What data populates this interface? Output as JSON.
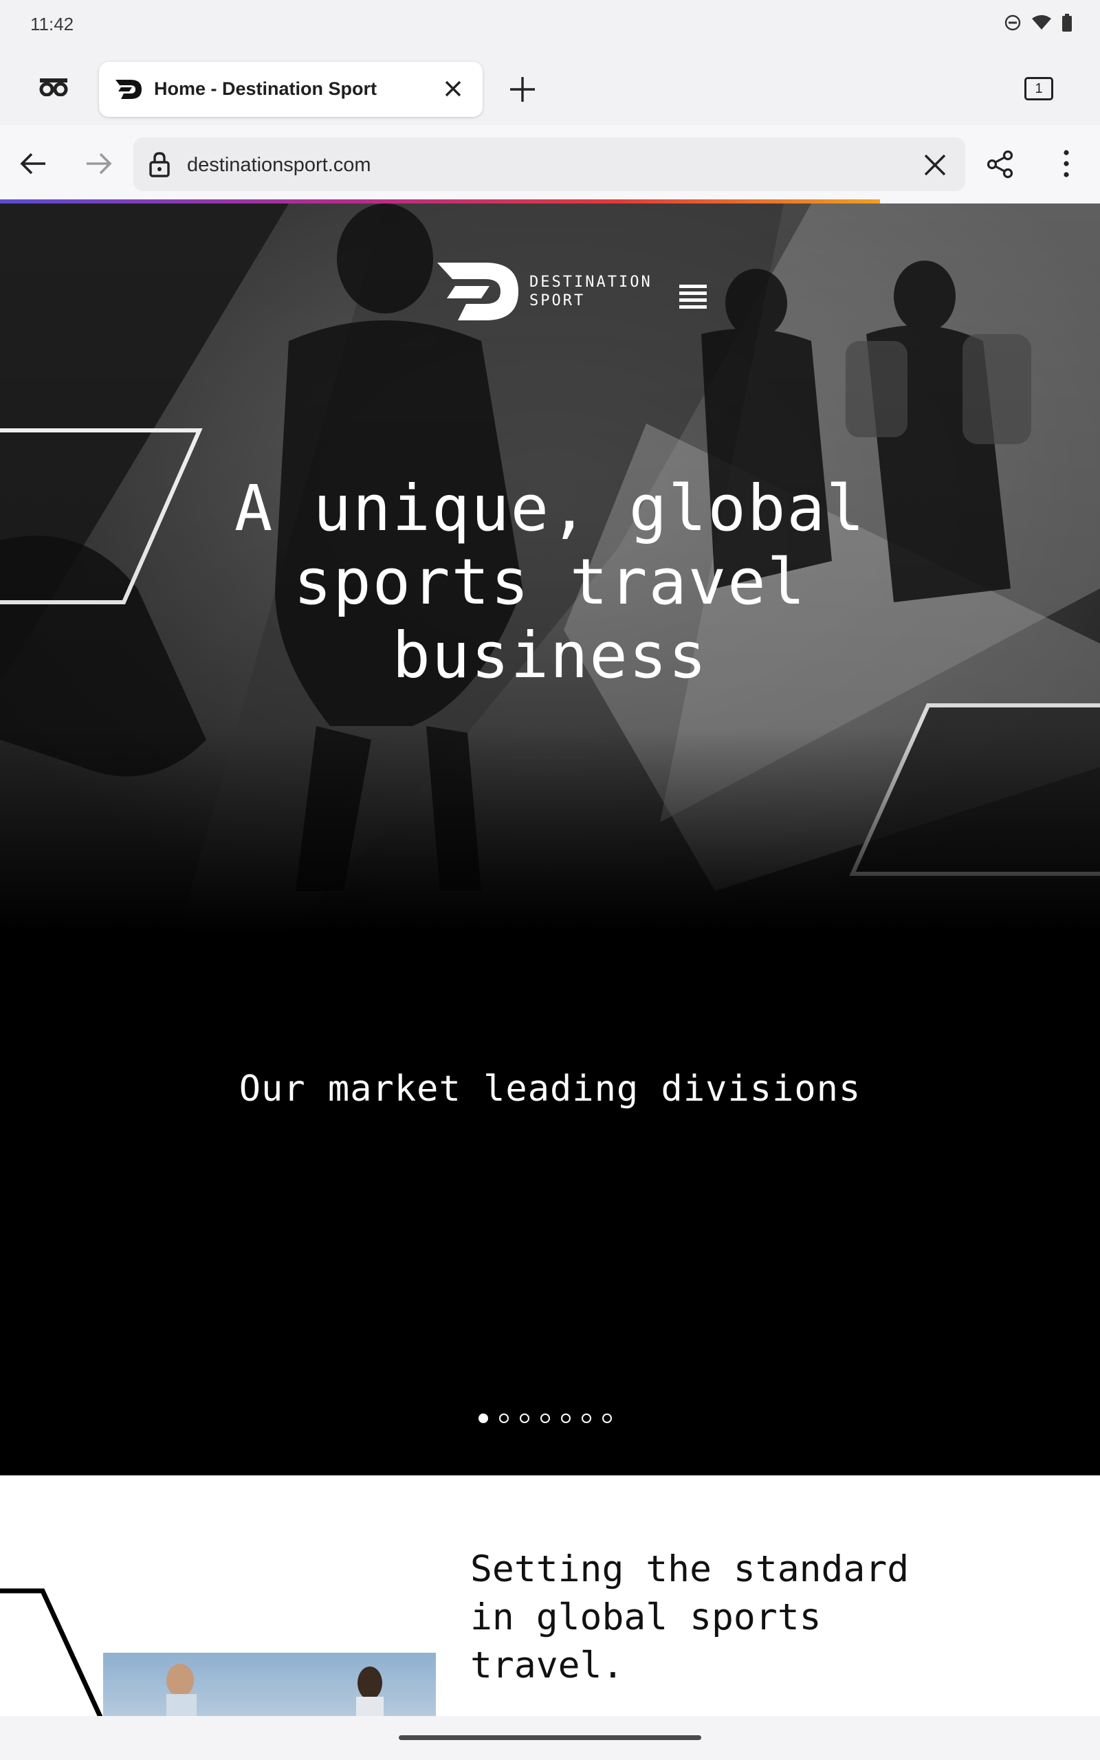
{
  "status": {
    "time": "11:42"
  },
  "browser": {
    "tab_title": "Home - Destination Sport",
    "tab_count": "1",
    "url": "destinationsport.com"
  },
  "icons": [
    "incognito-icon",
    "site-favicon",
    "close-tab-icon",
    "new-tab-icon",
    "tab-switcher-icon",
    "back-arrow-icon",
    "forward-arrow-icon",
    "lock-icon",
    "clear-url-icon",
    "share-icon",
    "more-menu-icon",
    "hamburger-menu-icon"
  ],
  "site": {
    "brand_line1": "DESTINATION",
    "brand_line2": "SPORT",
    "headline_line1": "A unique, global",
    "headline_line2": "sports travel",
    "headline_line3": "business",
    "divisions_heading": "Our market leading divisions",
    "carousel_slide_count": 7,
    "carousel_active_slide": 1,
    "intro_line1": "Setting the standard",
    "intro_line2": "in global sports",
    "intro_line3": "travel."
  }
}
